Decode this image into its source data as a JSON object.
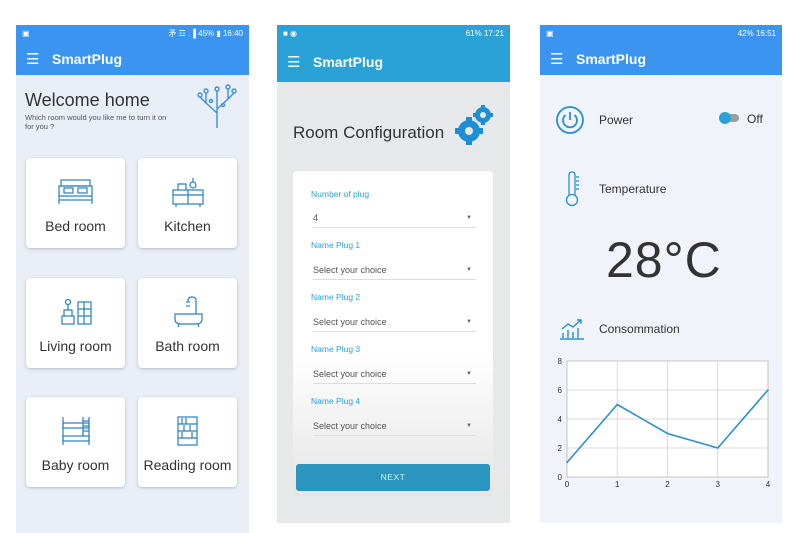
{
  "phone1": {
    "status": {
      "right": "⽭ ☲ .▐ 45% ▮ 16:40"
    },
    "app_title": "SmartPlug",
    "welcome": "Welcome home",
    "subtitle": "Which room would you like me to turn it on for you ?",
    "rooms": [
      {
        "label": "Bed room",
        "icon": "bed-icon"
      },
      {
        "label": "Kitchen",
        "icon": "kitchen-icon"
      },
      {
        "label": "Living room",
        "icon": "living-room-icon"
      },
      {
        "label": "Bath room",
        "icon": "bathtub-icon"
      },
      {
        "label": "Baby room",
        "icon": "bunk-bed-icon"
      },
      {
        "label": "Reading room",
        "icon": "bookshelf-icon"
      }
    ]
  },
  "phone2": {
    "status": {
      "right": "61% 17:21"
    },
    "app_title": "SmartPlug",
    "page_title": "Room Configuration",
    "number_of_plug_label": "Number of plug",
    "number_of_plug_value": "4",
    "plugs": [
      {
        "label": "Name Plug 1",
        "placeholder": "Select your choice"
      },
      {
        "label": "Name Plug 2",
        "placeholder": "Select your choice"
      },
      {
        "label": "Name Plug 3",
        "placeholder": "Select your choice"
      },
      {
        "label": "Name Plug 4",
        "placeholder": "Select your choice"
      }
    ],
    "next_label": "NEXT"
  },
  "phone3": {
    "status": {
      "right": "42% 16:51"
    },
    "app_title": "SmartPlug",
    "power_label": "Power",
    "power_state": "Off",
    "temperature_label": "Temperature",
    "temperature_value": "28°C",
    "consumption_label": "Consommation"
  },
  "colors": {
    "app_blue": "#3b94f0",
    "config_blue": "#2aa2d8",
    "icon_blue": "#2a7fbf"
  },
  "chart_data": {
    "type": "line",
    "x": [
      0,
      1,
      2,
      3,
      4
    ],
    "y": [
      1,
      5,
      3,
      2,
      6
    ],
    "xlim": [
      0,
      4
    ],
    "ylim": [
      0,
      8
    ],
    "x_ticks": [
      "0",
      "1",
      "2",
      "3",
      "4"
    ],
    "y_ticks": [
      "0",
      "2",
      "4",
      "6",
      "8"
    ],
    "grid": true,
    "line_color": "#2a8fd0"
  }
}
